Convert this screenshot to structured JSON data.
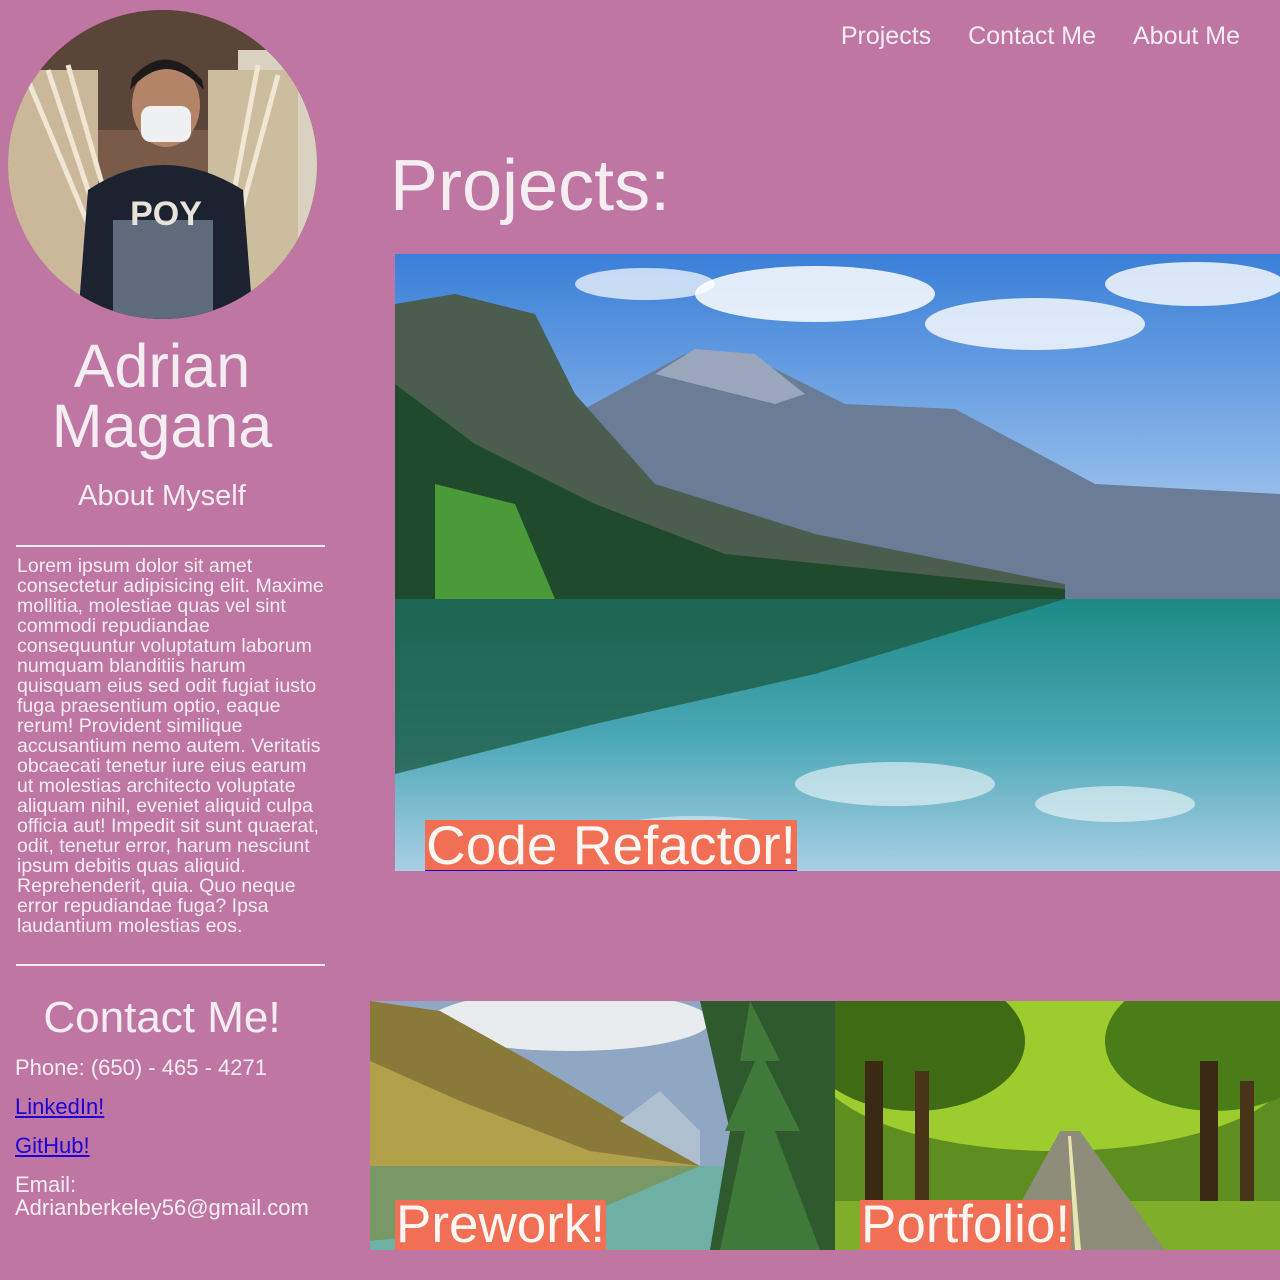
{
  "nav": {
    "items": [
      {
        "label": "Projects"
      },
      {
        "label": "Contact Me"
      },
      {
        "label": "About Me"
      }
    ]
  },
  "profile": {
    "name": "Adrian Magana",
    "about_heading": "About Myself",
    "about_text": "Lorem ipsum dolor sit amet consectetur adipisicing elit. Maxime mollitia, molestiae quas vel sint commodi repudiandae consequuntur voluptatum laborum numquam blanditiis harum quisquam eius sed odit fugiat iusto fuga praesentium optio, eaque rerum! Provident similique accusantium nemo autem. Veritatis obcaecati tenetur iure eius earum ut molestias architecto voluptate aliquam nihil, eveniet aliquid culpa officia aut! Impedit sit sunt quaerat, odit, tenetur error, harum nesciunt ipsum debitis quas aliquid. Reprehenderit, quia. Quo neque error repudiandae fuga? Ipsa laudantium molestias eos."
  },
  "contact": {
    "heading": "Contact Me!",
    "phone": "Phone: (650) - 465 - 4271",
    "linkedin": "LinkedIn!",
    "github": "GitHub!",
    "email_label": "Email:",
    "email": "Adrianberkeley56@gmail.com"
  },
  "projects": {
    "heading": "Projects:",
    "items": [
      {
        "label": "Code Refactor!"
      },
      {
        "label": "Prework!"
      },
      {
        "label": "Portfolio!"
      }
    ]
  },
  "colors": {
    "background": "#c076a3",
    "text": "#f4eef2",
    "label_background": "#f06f55",
    "link": "#1c00d6"
  }
}
